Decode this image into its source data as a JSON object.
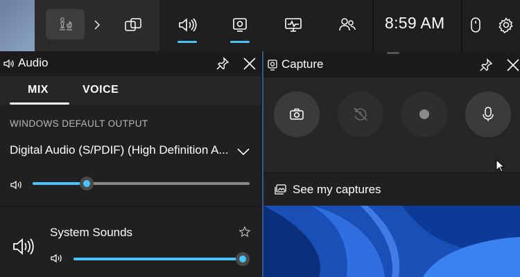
{
  "topbar": {
    "time": "8:59 AM",
    "accent_color": "#4cc2ff",
    "buttons": [
      {
        "name": "widget-menu-icon",
        "active": false
      },
      {
        "name": "audio-icon",
        "active": true
      },
      {
        "name": "capture-icon",
        "active": true
      },
      {
        "name": "performance-icon",
        "active": false
      },
      {
        "name": "social-icon",
        "active": false
      }
    ]
  },
  "audio": {
    "title": "Audio",
    "tabs": [
      {
        "label": "MIX",
        "selected": true
      },
      {
        "label": "VOICE",
        "selected": false
      }
    ],
    "section_label": "WINDOWS DEFAULT OUTPUT",
    "device": "Digital Audio (S/PDIF) (High Definition A...",
    "master_volume": 0.25,
    "apps": [
      {
        "name": "System Sounds",
        "volume": 1.0
      }
    ]
  },
  "capture": {
    "title": "Capture",
    "see_captures": "See my captures",
    "buttons": [
      {
        "name": "screenshot-icon",
        "enabled": true
      },
      {
        "name": "record-last-icon",
        "enabled": false
      },
      {
        "name": "record-icon",
        "enabled": false
      },
      {
        "name": "microphone-icon",
        "enabled": true
      }
    ]
  }
}
